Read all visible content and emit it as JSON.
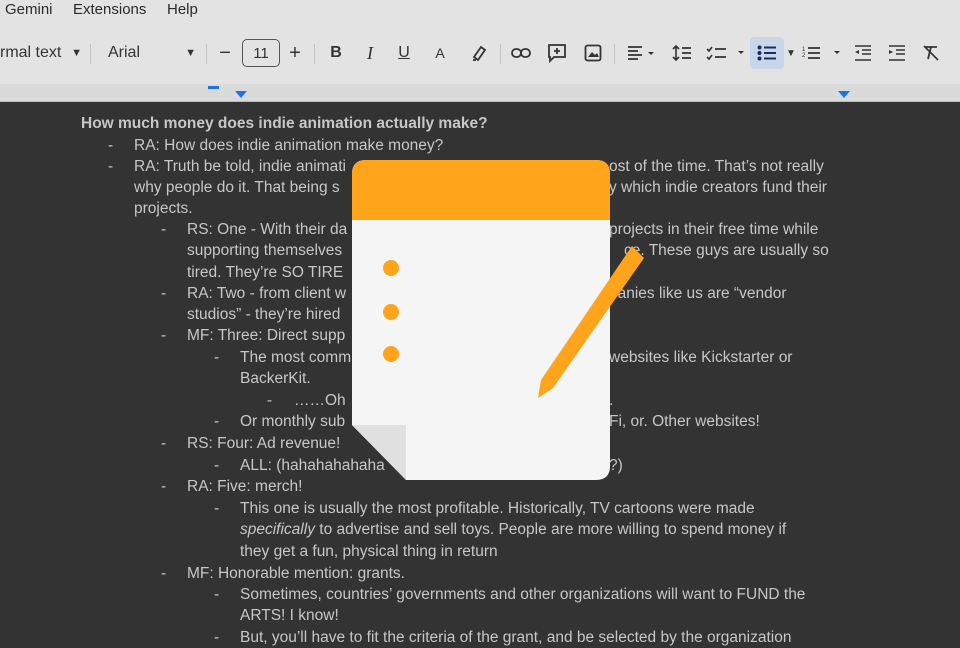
{
  "menubar": {
    "items": [
      "Gemini",
      "Extensions",
      "Help"
    ]
  },
  "toolbar": {
    "style_label": "rmal text",
    "font_label": "Arial",
    "font_size": "11",
    "minus": "−",
    "plus": "+",
    "bold": "B",
    "italic": "I",
    "underline": "U",
    "text_color": "A"
  },
  "doc": {
    "heading": "How much money does indie animation actually make?",
    "dash": "-",
    "lines": [
      "RA: How does indie animation make money?",
      "RA: Truth be told, indie animati",
      "why people do it. That being s",
      "projects.",
      "RS: One - With their da",
      "supporting themselves",
      "tired. They’re SO TIRE",
      "RA: Two - from client w",
      "studios” - they’re hired",
      "MF: Three: Direct supp",
      "The most comm",
      "BackerKit.",
      "……Oh",
      "Or monthly sub",
      "RS: Four: Ad revenue!",
      "ALL: (hahahahahaha",
      "RA: Five: merch!",
      "This one is usually the most profitable. Historically, TV cartoons were made",
      "specifically",
      " to advertise and sell toys. People are more willing to spend money if",
      "they get a fun, physical thing in return",
      "MF: Honorable mention: grants.",
      "Sometimes, countries’ governments and other organizations will want to FUND the",
      "ARTS! I know!",
      "But, you’ll have to fit the criteria of the grant, and be selected by the organization"
    ],
    "right_fragments": [
      "ost of the time.  That’s not really",
      "y which indie creators fund their",
      "projects in their free time while",
      "ce. These guys are usually so",
      "panies like us are “vendor",
      "websites like Kickstarter or",
      ".",
      "Fi, or. Other websites!",
      "?)"
    ]
  },
  "colors": {
    "accent": "#FFA41B",
    "paper": "#F5F5F5",
    "doc_bg": "#333333",
    "toolbar_bg": "#E3E3E3"
  },
  "overlay": {
    "icon": "notes-pencil-icon"
  }
}
